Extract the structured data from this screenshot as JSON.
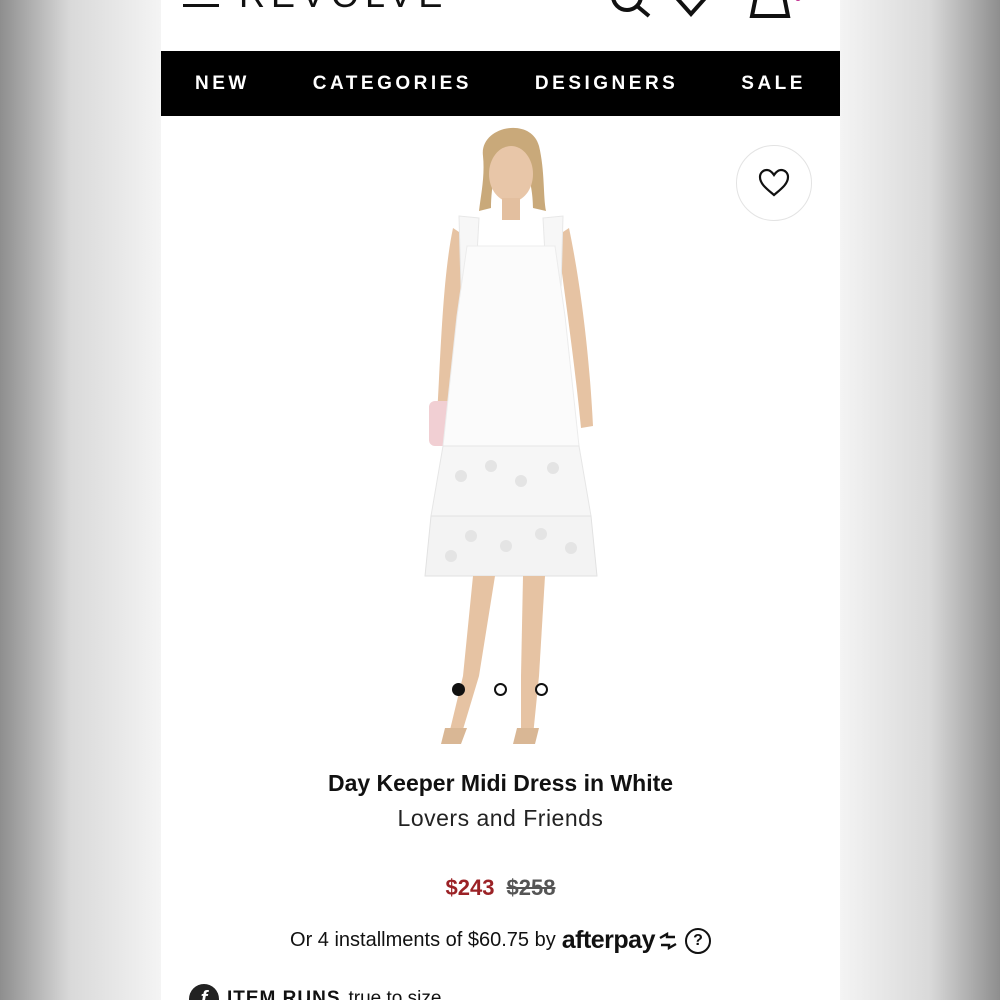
{
  "header": {
    "logo": "REVOLVE"
  },
  "nav": {
    "items": [
      "NEW",
      "CATEGORIES",
      "DESIGNERS",
      "SALE"
    ]
  },
  "gallery": {
    "image_count": 3,
    "active_index": 0
  },
  "product": {
    "title": "Day Keeper Midi Dress in White",
    "designer": "Lovers and Friends",
    "sale_price": "$243",
    "original_price": "$258"
  },
  "installments": {
    "text": "Or 4 installments of $60.75 by",
    "brand": "afterpay",
    "help": "?"
  },
  "fit": {
    "icon_letter": "f",
    "label": "ITEM RUNS",
    "value": "true to size"
  },
  "colors": {
    "nav_bg": "#000000",
    "sale_price": "#9b2226",
    "badge_accent": "#c0268c"
  }
}
